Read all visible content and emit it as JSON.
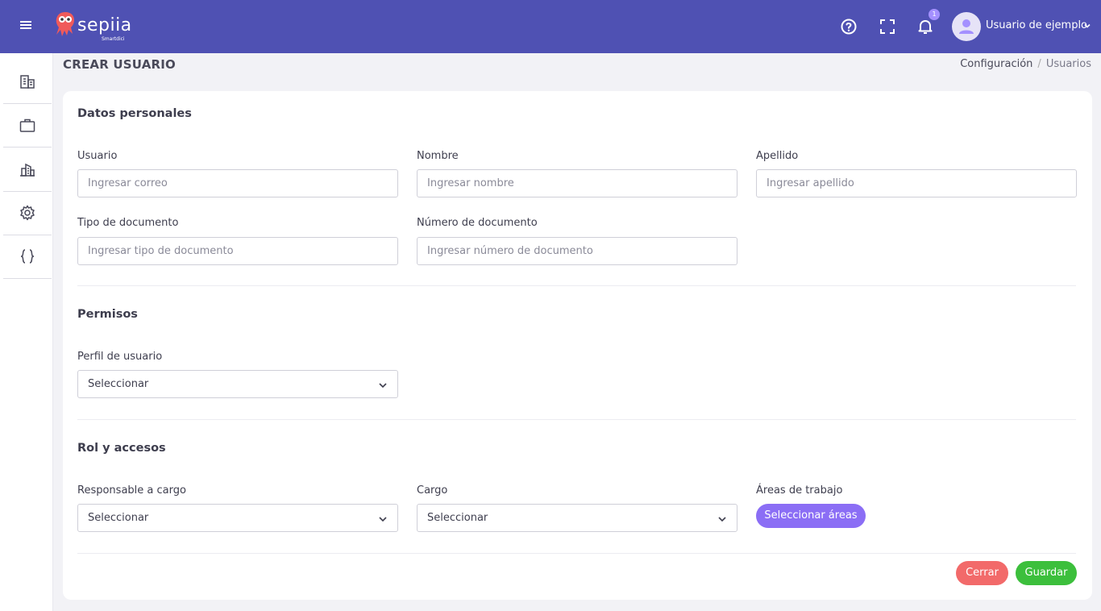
{
  "brand": {
    "name": "sepiia",
    "tagline": "Smartdici"
  },
  "topbar": {
    "notification_count": "1",
    "user_name": "Usuario de ejemplo",
    "icons": [
      "menu-icon",
      "help-icon",
      "fullscreen-icon",
      "bell-icon",
      "user-avatar-icon",
      "chevron-down-icon"
    ]
  },
  "sidebar": {
    "items": [
      {
        "icon": "building-icon"
      },
      {
        "icon": "briefcase-icon"
      },
      {
        "icon": "city-icon"
      },
      {
        "icon": "gear-icon"
      },
      {
        "icon": "code-braces-icon"
      }
    ]
  },
  "page": {
    "title": "CREAR USUARIO",
    "breadcrumb": [
      "Configuración",
      "Usuarios"
    ]
  },
  "personal": {
    "title": "Datos personales",
    "usuario": {
      "label": "Usuario",
      "placeholder": "Ingresar correo",
      "value": ""
    },
    "nombre": {
      "label": "Nombre",
      "placeholder": "Ingresar nombre",
      "value": ""
    },
    "apellido": {
      "label": "Apellido",
      "placeholder": "Ingresar apellido",
      "value": ""
    },
    "tipo_doc": {
      "label": "Tipo de documento",
      "placeholder": "Ingresar tipo de documento",
      "value": ""
    },
    "num_doc": {
      "label": "Número de documento",
      "placeholder": "Ingresar número de documento",
      "value": ""
    }
  },
  "permisos": {
    "title": "Permisos",
    "perfil": {
      "label": "Perfil de usuario",
      "value": "Seleccionar"
    }
  },
  "rol": {
    "title": "Rol y accesos",
    "responsable": {
      "label": "Responsable a cargo",
      "value": "Seleccionar"
    },
    "cargo": {
      "label": "Cargo",
      "value": "Seleccionar"
    },
    "areas": {
      "label": "Áreas de trabajo",
      "button": "Seleccionar áreas"
    }
  },
  "actions": {
    "close": "Cerrar",
    "save": "Guardar"
  },
  "colors": {
    "topbar": "#4f51b3",
    "accent": "#8b6ef5",
    "close": "#f26a6a",
    "save": "#3cbf3c",
    "badge": "#a490ff"
  }
}
